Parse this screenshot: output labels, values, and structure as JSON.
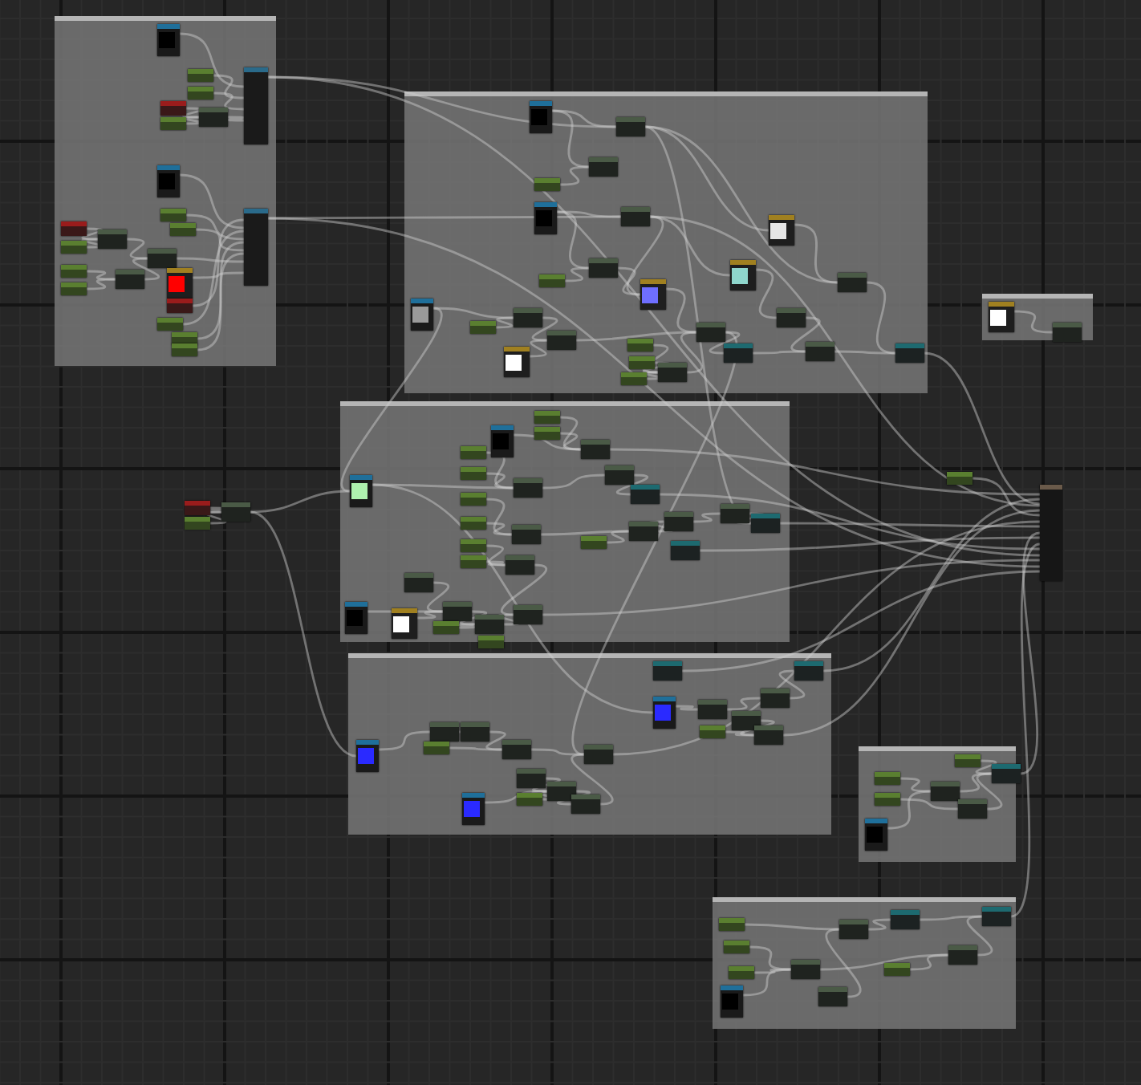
{
  "graph": {
    "nodes": [
      {
        "kind": "texture",
        "color": "#000000"
      },
      {
        "kind": "param"
      },
      {
        "kind": "param"
      },
      {
        "kind": "vector"
      },
      {
        "kind": "param"
      },
      {
        "kind": "math"
      },
      {
        "kind": "function"
      },
      {
        "kind": "texture",
        "color": "#000000"
      },
      {
        "kind": "param"
      },
      {
        "kind": "param"
      },
      {
        "kind": "vector"
      },
      {
        "kind": "param"
      },
      {
        "kind": "math"
      },
      {
        "kind": "param"
      },
      {
        "kind": "param"
      },
      {
        "kind": "math"
      },
      {
        "kind": "math"
      },
      {
        "kind": "preview",
        "color": "#ff0000"
      },
      {
        "kind": "vector"
      },
      {
        "kind": "param"
      },
      {
        "kind": "param"
      },
      {
        "kind": "param"
      },
      {
        "kind": "function"
      },
      {
        "kind": "texture",
        "color": "#000000"
      },
      {
        "kind": "math"
      },
      {
        "kind": "math"
      },
      {
        "kind": "param"
      },
      {
        "kind": "texture",
        "color": "#000000"
      },
      {
        "kind": "math"
      },
      {
        "kind": "math"
      },
      {
        "kind": "param"
      },
      {
        "kind": "preview",
        "color": "#6e6eff"
      },
      {
        "kind": "preview",
        "color": "#e6e6e6"
      },
      {
        "kind": "preview",
        "color": "#8fd6cc"
      },
      {
        "kind": "math"
      },
      {
        "kind": "math"
      },
      {
        "kind": "texture",
        "color": "#9a9a9a"
      },
      {
        "kind": "param"
      },
      {
        "kind": "math"
      },
      {
        "kind": "math"
      },
      {
        "kind": "preview",
        "color": "#ffffff"
      },
      {
        "kind": "param"
      },
      {
        "kind": "param"
      },
      {
        "kind": "math"
      },
      {
        "kind": "param"
      },
      {
        "kind": "math"
      },
      {
        "kind": "sampler"
      },
      {
        "kind": "math"
      },
      {
        "kind": "sampler"
      },
      {
        "kind": "preview",
        "color": "#ffffff"
      },
      {
        "kind": "math"
      },
      {
        "kind": "vector"
      },
      {
        "kind": "param"
      },
      {
        "kind": "math"
      },
      {
        "kind": "param"
      },
      {
        "kind": "output"
      },
      {
        "kind": "texture",
        "color": "#000000"
      },
      {
        "kind": "param"
      },
      {
        "kind": "param"
      },
      {
        "kind": "math"
      },
      {
        "kind": "param"
      },
      {
        "kind": "param"
      },
      {
        "kind": "texture",
        "color": "#aef0ae"
      },
      {
        "kind": "math"
      },
      {
        "kind": "math"
      },
      {
        "kind": "param"
      },
      {
        "kind": "param"
      },
      {
        "kind": "sampler"
      },
      {
        "kind": "math"
      },
      {
        "kind": "param"
      },
      {
        "kind": "param"
      },
      {
        "kind": "math"
      },
      {
        "kind": "math"
      },
      {
        "kind": "param"
      },
      {
        "kind": "math"
      },
      {
        "kind": "sampler"
      },
      {
        "kind": "sampler"
      },
      {
        "kind": "math"
      },
      {
        "kind": "math"
      },
      {
        "kind": "texture",
        "color": "#000000"
      },
      {
        "kind": "preview",
        "color": "#ffffff"
      },
      {
        "kind": "math"
      },
      {
        "kind": "param"
      },
      {
        "kind": "math"
      },
      {
        "kind": "math"
      },
      {
        "kind": "param"
      },
      {
        "kind": "sampler"
      },
      {
        "kind": "sampler"
      },
      {
        "kind": "texture",
        "color": "#2a2aff"
      },
      {
        "kind": "math"
      },
      {
        "kind": "math"
      },
      {
        "kind": "math"
      },
      {
        "kind": "param"
      },
      {
        "kind": "math"
      },
      {
        "kind": "texture",
        "color": "#2a2aff"
      },
      {
        "kind": "math"
      },
      {
        "kind": "math"
      },
      {
        "kind": "param"
      },
      {
        "kind": "math"
      },
      {
        "kind": "math"
      },
      {
        "kind": "math"
      },
      {
        "kind": "param"
      },
      {
        "kind": "math"
      },
      {
        "kind": "math"
      },
      {
        "kind": "texture",
        "color": "#2a2aff"
      },
      {
        "kind": "param"
      },
      {
        "kind": "param"
      },
      {
        "kind": "math"
      },
      {
        "kind": "sampler"
      },
      {
        "kind": "param"
      },
      {
        "kind": "math"
      },
      {
        "kind": "texture",
        "color": "#000000"
      },
      {
        "kind": "param"
      },
      {
        "kind": "math"
      },
      {
        "kind": "sampler"
      },
      {
        "kind": "sampler"
      },
      {
        "kind": "param"
      },
      {
        "kind": "param"
      },
      {
        "kind": "math"
      },
      {
        "kind": "param"
      },
      {
        "kind": "math"
      },
      {
        "kind": "math"
      },
      {
        "kind": "texture",
        "color": "#000000"
      }
    ]
  }
}
